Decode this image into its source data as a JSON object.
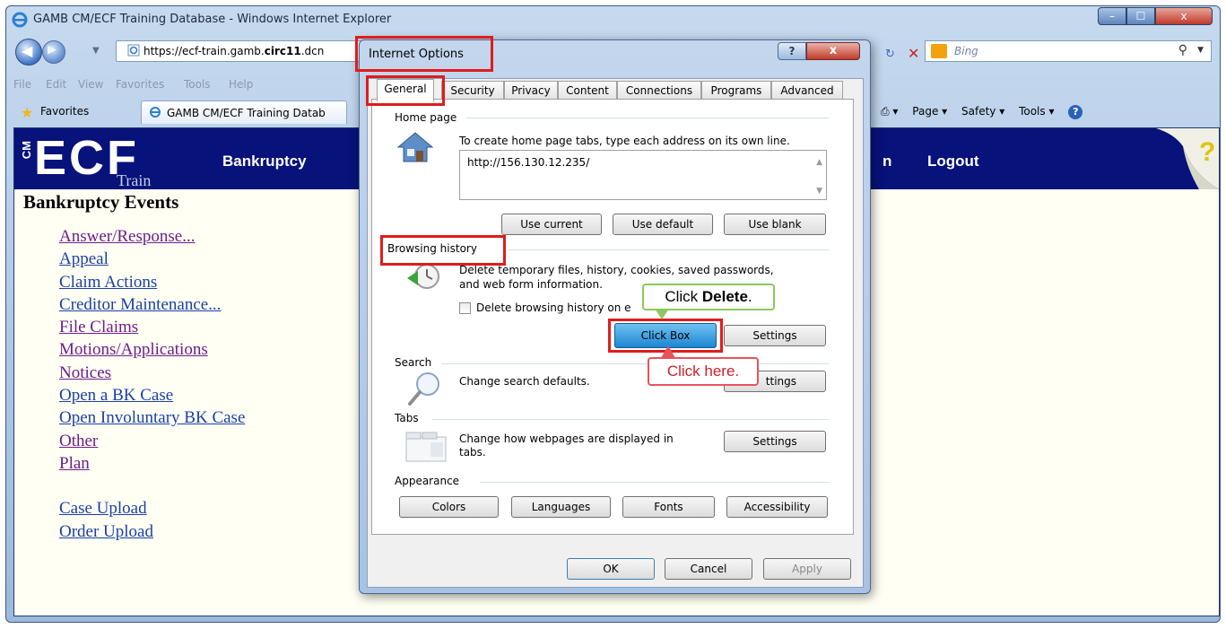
{
  "window": {
    "title": "GAMB CM/ECF Training Database - Windows Internet Explorer",
    "minimize": "–",
    "maximize": "☐",
    "close": "x"
  },
  "address_bar": {
    "url_prefix": "https://ecf-train.gamb.",
    "url_bold": "circ11",
    "url_suffix": ".dcn"
  },
  "search": {
    "placeholder": "Bing",
    "icon": "search-icon"
  },
  "menu": [
    "File",
    "Edit",
    "View",
    "Favorites",
    "Tools",
    "Help"
  ],
  "favorites_bar": {
    "label": "Favorites",
    "tab_title": "GAMB CM/ECF Training Datab",
    "tools": [
      "Page ▾",
      "Safety ▾",
      "Tools ▾"
    ]
  },
  "ecf_page": {
    "logo_text": "ECF",
    "logo_cm": "CM",
    "logo_train": "Train",
    "nav_bankruptcy": "Bankruptcy",
    "nav_partial": "n",
    "nav_logout": "Logout",
    "help_glyph": "?",
    "heading": "Bankruptcy Events",
    "events": [
      {
        "label": "Answer/Response...",
        "visited": true
      },
      {
        "label": "Appeal",
        "visited": false
      },
      {
        "label": "Claim Actions",
        "visited": false
      },
      {
        "label": "Creditor Maintenance...",
        "visited": false
      },
      {
        "label": "File Claims",
        "visited": true
      },
      {
        "label": "Motions/Applications",
        "visited": true
      },
      {
        "label": "Notices",
        "visited": true
      },
      {
        "label": "Open a BK Case",
        "visited": false
      },
      {
        "label": "Open Involuntary BK Case",
        "visited": false
      },
      {
        "label": "Other",
        "visited": true
      },
      {
        "label": "Plan",
        "visited": true
      }
    ],
    "uploads": [
      "Case Upload",
      "Order Upload"
    ]
  },
  "dialog": {
    "title": "Internet Options",
    "help_button": "?",
    "close_button": "x",
    "tabs": [
      "General",
      "Security",
      "Privacy",
      "Content",
      "Connections",
      "Programs",
      "Advanced"
    ],
    "home_page": {
      "title": "Home page",
      "instruction": "To create home page tabs, type each address on its own line.",
      "value": "http://156.130.12.235/",
      "use_current": "Use current",
      "use_default": "Use default",
      "use_blank": "Use blank"
    },
    "browsing_history": {
      "title": "Browsing history",
      "description_line1": "Delete temporary files, history, cookies, saved passwords,",
      "description_line2": "and web form information.",
      "checkbox_label": "Delete browsing history on e",
      "delete_button": "Click Box",
      "settings": "Settings"
    },
    "search": {
      "title": "Search",
      "description": "Change search defaults.",
      "settings": "ttings"
    },
    "tabs_group": {
      "title": "Tabs",
      "description_line1": "Change how webpages are displayed in",
      "description_line2": "tabs.",
      "settings": "Settings"
    },
    "appearance": {
      "title": "Appearance",
      "buttons": [
        "Colors",
        "Languages",
        "Fonts",
        "Accessibility"
      ]
    },
    "footer": {
      "ok": "OK",
      "cancel": "Cancel",
      "apply": "Apply"
    }
  },
  "callouts": {
    "delete_prefix": "Click ",
    "delete_bold": "Delete",
    "delete_suffix": ".",
    "here": "Click here."
  },
  "colors": {
    "banner": "#07127a",
    "highlight": "#e01c1c",
    "visited_link": "#6d1d8c",
    "unvisited_link": "#1a3fa8"
  }
}
